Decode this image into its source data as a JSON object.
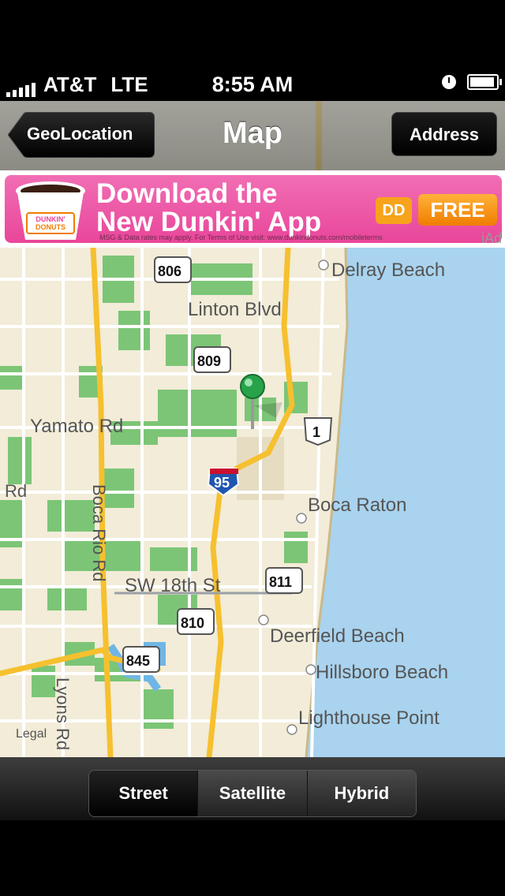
{
  "status_bar": {
    "carrier": "AT&T",
    "network": "LTE",
    "time": "8:55 AM"
  },
  "nav_bar": {
    "back_label": "GeoLocation",
    "title": "Map",
    "right_label": "Address"
  },
  "ad": {
    "line1": "Download the",
    "line2": "New Dunkin' App",
    "dd_logo": "DD",
    "cta": "FREE",
    "fine_print": "MSG & Data rates may apply. For Terms of Use visit: www.dunkindonuts.com/mobileterms",
    "network": "iAd",
    "cup_brand_line1": "DUNKIN'",
    "cup_brand_line2": "DONUTS"
  },
  "map": {
    "place_labels": [
      "Delray Beach",
      "Linton Blvd",
      "Yamato Rd",
      "Boca Raton",
      "SW 18th St",
      "Deerfield Beach",
      "Hillsboro Beach",
      "Lighthouse Point",
      "Boca Rio Rd",
      "Lyons Rd",
      "Rd"
    ],
    "route_shields": [
      "806",
      "809",
      "1",
      "95",
      "811",
      "810",
      "845"
    ],
    "legal": "Legal",
    "colors": {
      "land": "#f2ecd8",
      "water": "#a9d3ee",
      "park": "#7cc576",
      "highway": "#f6c02e",
      "road": "#ffffff"
    }
  },
  "segmented": {
    "items": [
      "Street",
      "Satellite",
      "Hybrid"
    ],
    "selected": "Street"
  }
}
